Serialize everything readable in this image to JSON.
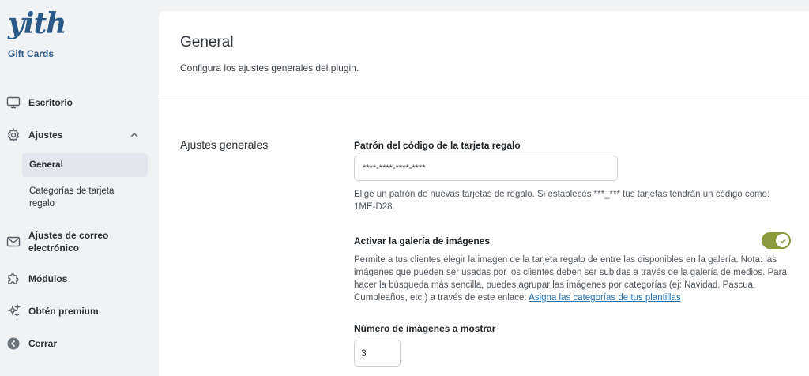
{
  "brand": {
    "logo_text": "yith",
    "product_name": "Gift Cards",
    "accent_color": "#8a9a3d",
    "logo_color": "#2b5a88"
  },
  "sidebar": {
    "items": [
      {
        "label": "Escritorio",
        "icon": "monitor-icon"
      },
      {
        "label": "Ajustes",
        "icon": "gear-icon",
        "expanded": true
      },
      {
        "label": "Ajustes de correo electrónico",
        "icon": "mail-icon"
      },
      {
        "label": "Módulos",
        "icon": "puzzle-icon"
      },
      {
        "label": "Obtén premium",
        "icon": "sparkle-icon"
      },
      {
        "label": "Cerrar",
        "icon": "back-arrow-icon"
      }
    ],
    "submenu": [
      {
        "label": "General",
        "active": true
      },
      {
        "label": "Categorías de tarjeta regalo",
        "active": false
      }
    ]
  },
  "main": {
    "title": "General",
    "subtitle": "Configura los ajustes generales del plugin.",
    "section_title": "Ajustes generales",
    "fields": {
      "code_pattern": {
        "label": "Patrón del código de la tarjeta regalo",
        "value": "****-****-****-****",
        "help": "Elige un patrón de nuevas tarjetas de regalo. Si estableces ***_*** tus tarjetas tendrán un código como: 1ME-D28."
      },
      "gallery": {
        "label": "Activar la galería de imágenes",
        "enabled": true,
        "help": "Permite a tus clientes elegir la imagen de la tarjeta regalo de entre las disponibles en la galería. Nota: las imágenes que pueden ser usadas por los clientes deben ser subidas a través de la galería de medios. Para hacer la búsqueda más sencilla, puedes agrupar las imágenes por categorías (ej: Navidad, Pascua, Cumpleaños, etc.) a través de este enlace: ",
        "link_text": "Asigna las categorías de tus plantillas"
      },
      "image_count": {
        "label": "Número de imágenes a mostrar",
        "value": "3"
      }
    }
  }
}
